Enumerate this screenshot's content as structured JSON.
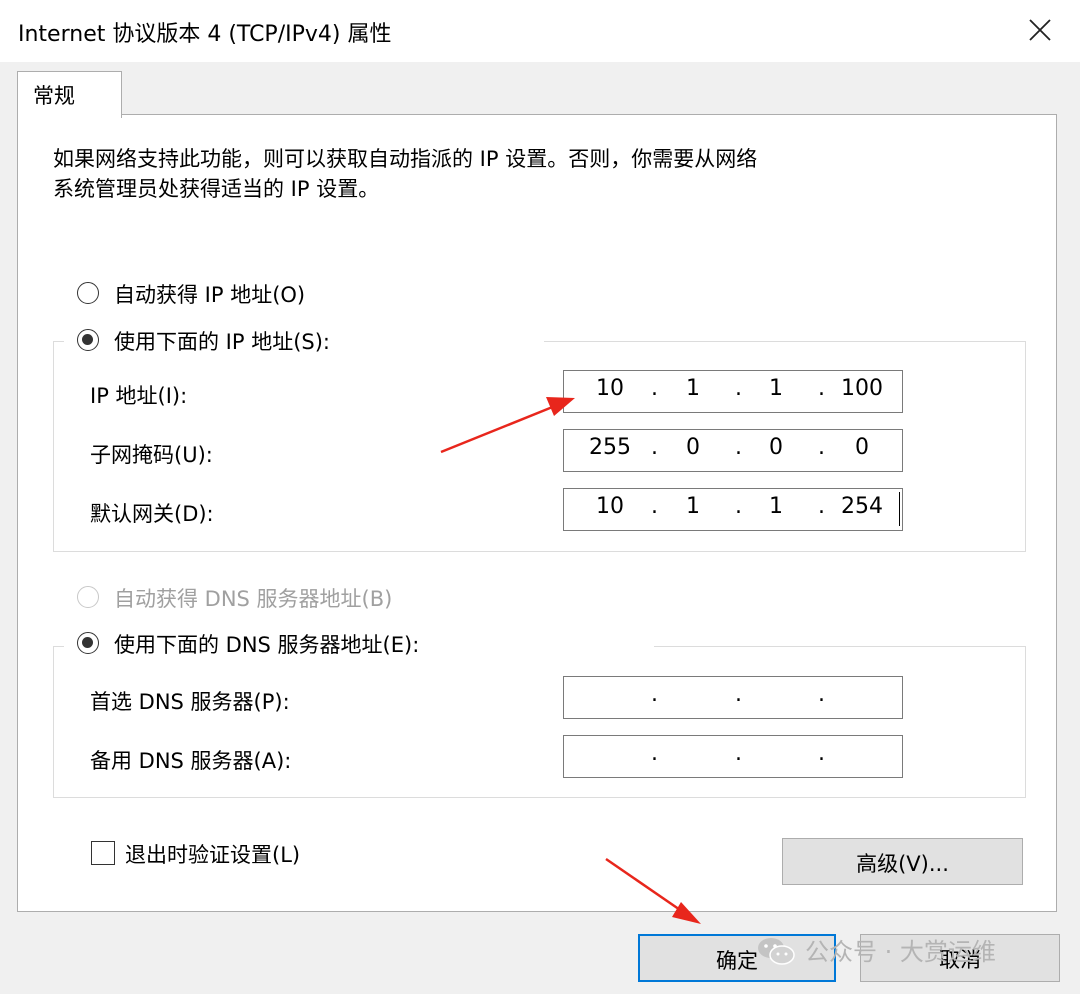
{
  "window": {
    "title": "Internet 协议版本 4 (TCP/IPv4) 属性"
  },
  "tabs": [
    {
      "label": "常规"
    }
  ],
  "description": {
    "line1": "如果网络支持此功能，则可以获取自动指派的 IP 设置。否则，你需要从网络",
    "line2": "系统管理员处获得适当的 IP 设置。"
  },
  "ip_section": {
    "auto_label": "自动获得 IP 地址(O)",
    "manual_label": "使用下面的 IP 地址(S):",
    "fields": [
      {
        "label": "IP 地址(I):",
        "octets": [
          "10",
          "1",
          "1",
          "100"
        ]
      },
      {
        "label": "子网掩码(U):",
        "octets": [
          "255",
          "0",
          "0",
          "0"
        ]
      },
      {
        "label": "默认网关(D):",
        "octets": [
          "10",
          "1",
          "1",
          "254"
        ]
      }
    ]
  },
  "dns_section": {
    "auto_label": "自动获得 DNS 服务器地址(B)",
    "manual_label": "使用下面的 DNS 服务器地址(E):",
    "fields": [
      {
        "label": "首选 DNS 服务器(P):",
        "octets": [
          "",
          "",
          "",
          ""
        ]
      },
      {
        "label": "备用 DNS 服务器(A):",
        "octets": [
          "",
          "",
          "",
          ""
        ]
      }
    ]
  },
  "validate_checkbox": {
    "label": "退出时验证设置(L)",
    "checked": false
  },
  "buttons": {
    "advanced": "高级(V)...",
    "ok": "确定",
    "cancel": "取消"
  },
  "watermark": {
    "text": "公众号 · 大赏运维"
  },
  "colors": {
    "annotation_arrow": "#e8261c",
    "default_button_border": "#0078d7"
  },
  "icons": {
    "close": "close-icon",
    "wechat": "wechat-icon"
  }
}
